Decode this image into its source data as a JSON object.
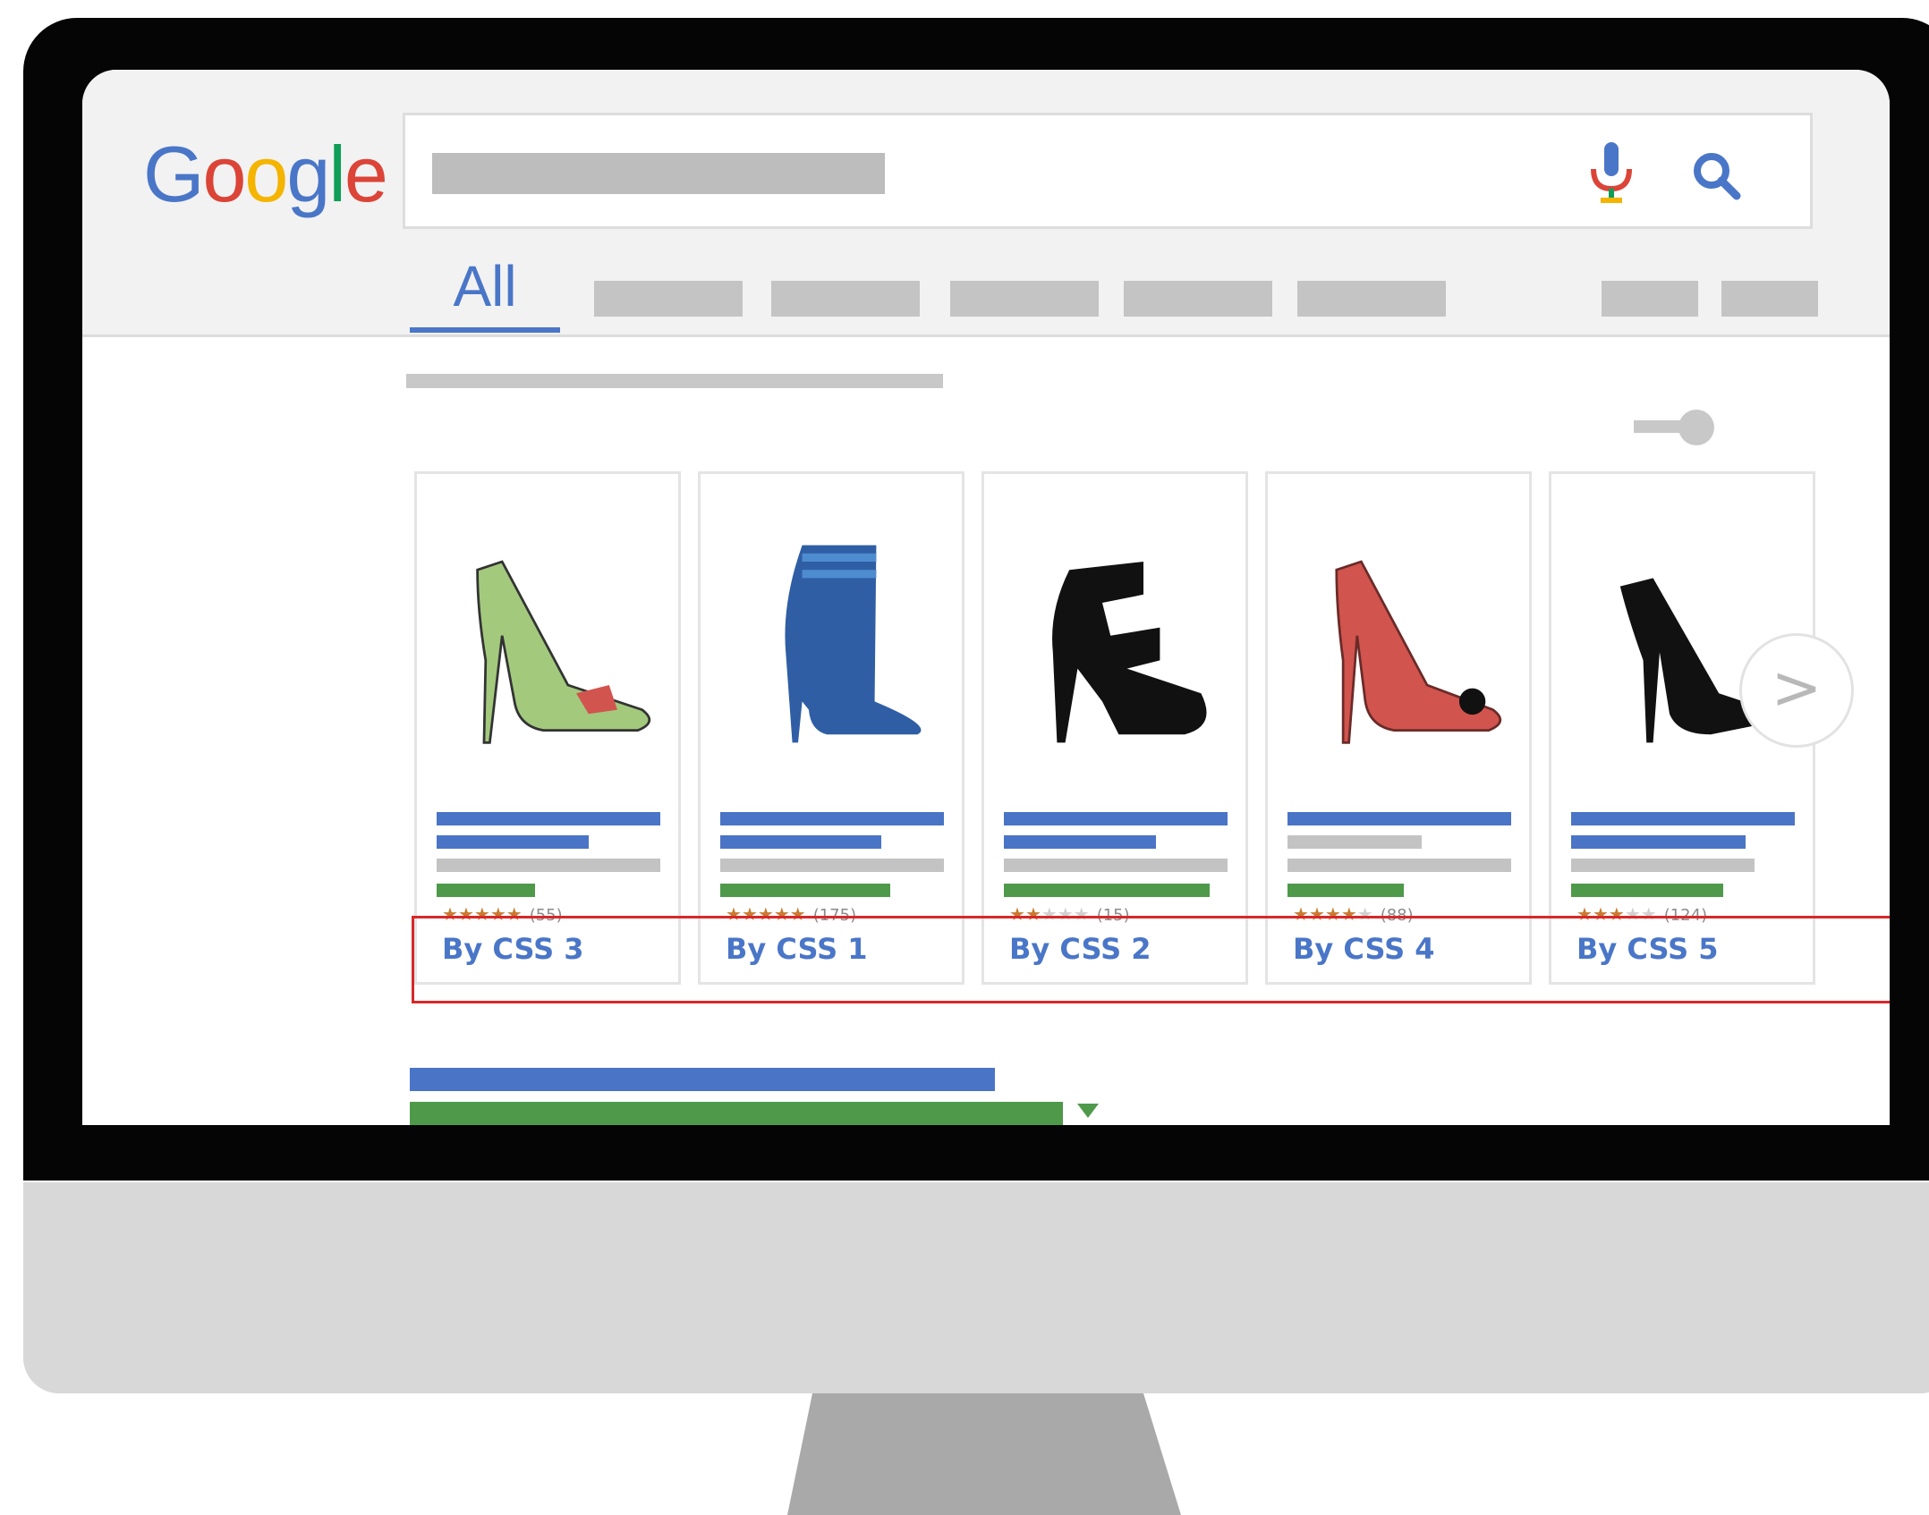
{
  "search": {
    "logo_letters": [
      {
        "char": "G",
        "color": "#4a76c8"
      },
      {
        "char": "o",
        "color": "#db4437"
      },
      {
        "char": "o",
        "color": "#f4b400"
      },
      {
        "char": "g",
        "color": "#4a76c8"
      },
      {
        "char": "l",
        "color": "#0f9d58"
      },
      {
        "char": "e",
        "color": "#db4437"
      }
    ],
    "mic_icon": "mic-icon",
    "search_icon": "magnifier-icon"
  },
  "tabs": {
    "active_label": "All"
  },
  "products": [
    {
      "seller": "By CSS 3",
      "stars": 5,
      "count": "(55)",
      "shoe_color": "#a3c97d",
      "shoe": "green-peep-toe-pump"
    },
    {
      "seller": "By CSS 1",
      "stars": 5,
      "count": "(175)",
      "shoe_color": "#2f5ea4",
      "shoe": "blue-ankle-boot"
    },
    {
      "seller": "By CSS 2",
      "stars": 2,
      "count": "(15)",
      "shoe_color": "#111111",
      "shoe": "black-strappy-sandal"
    },
    {
      "seller": "By CSS 4",
      "stars": 4,
      "count": "(88)",
      "shoe_color": "#d2544e",
      "shoe": "red-peep-toe-pump"
    },
    {
      "seller": "By CSS 5",
      "stars": 3,
      "count": "(124)",
      "shoe_color": "#111111",
      "shoe": "black-pump"
    }
  ],
  "carousel": {
    "next_label": ">"
  },
  "colors": {
    "link_blue": "#4a76c8",
    "url_green": "#4e9a4a",
    "highlight_red": "#d7282a",
    "rating_orange": "#c97a30"
  }
}
